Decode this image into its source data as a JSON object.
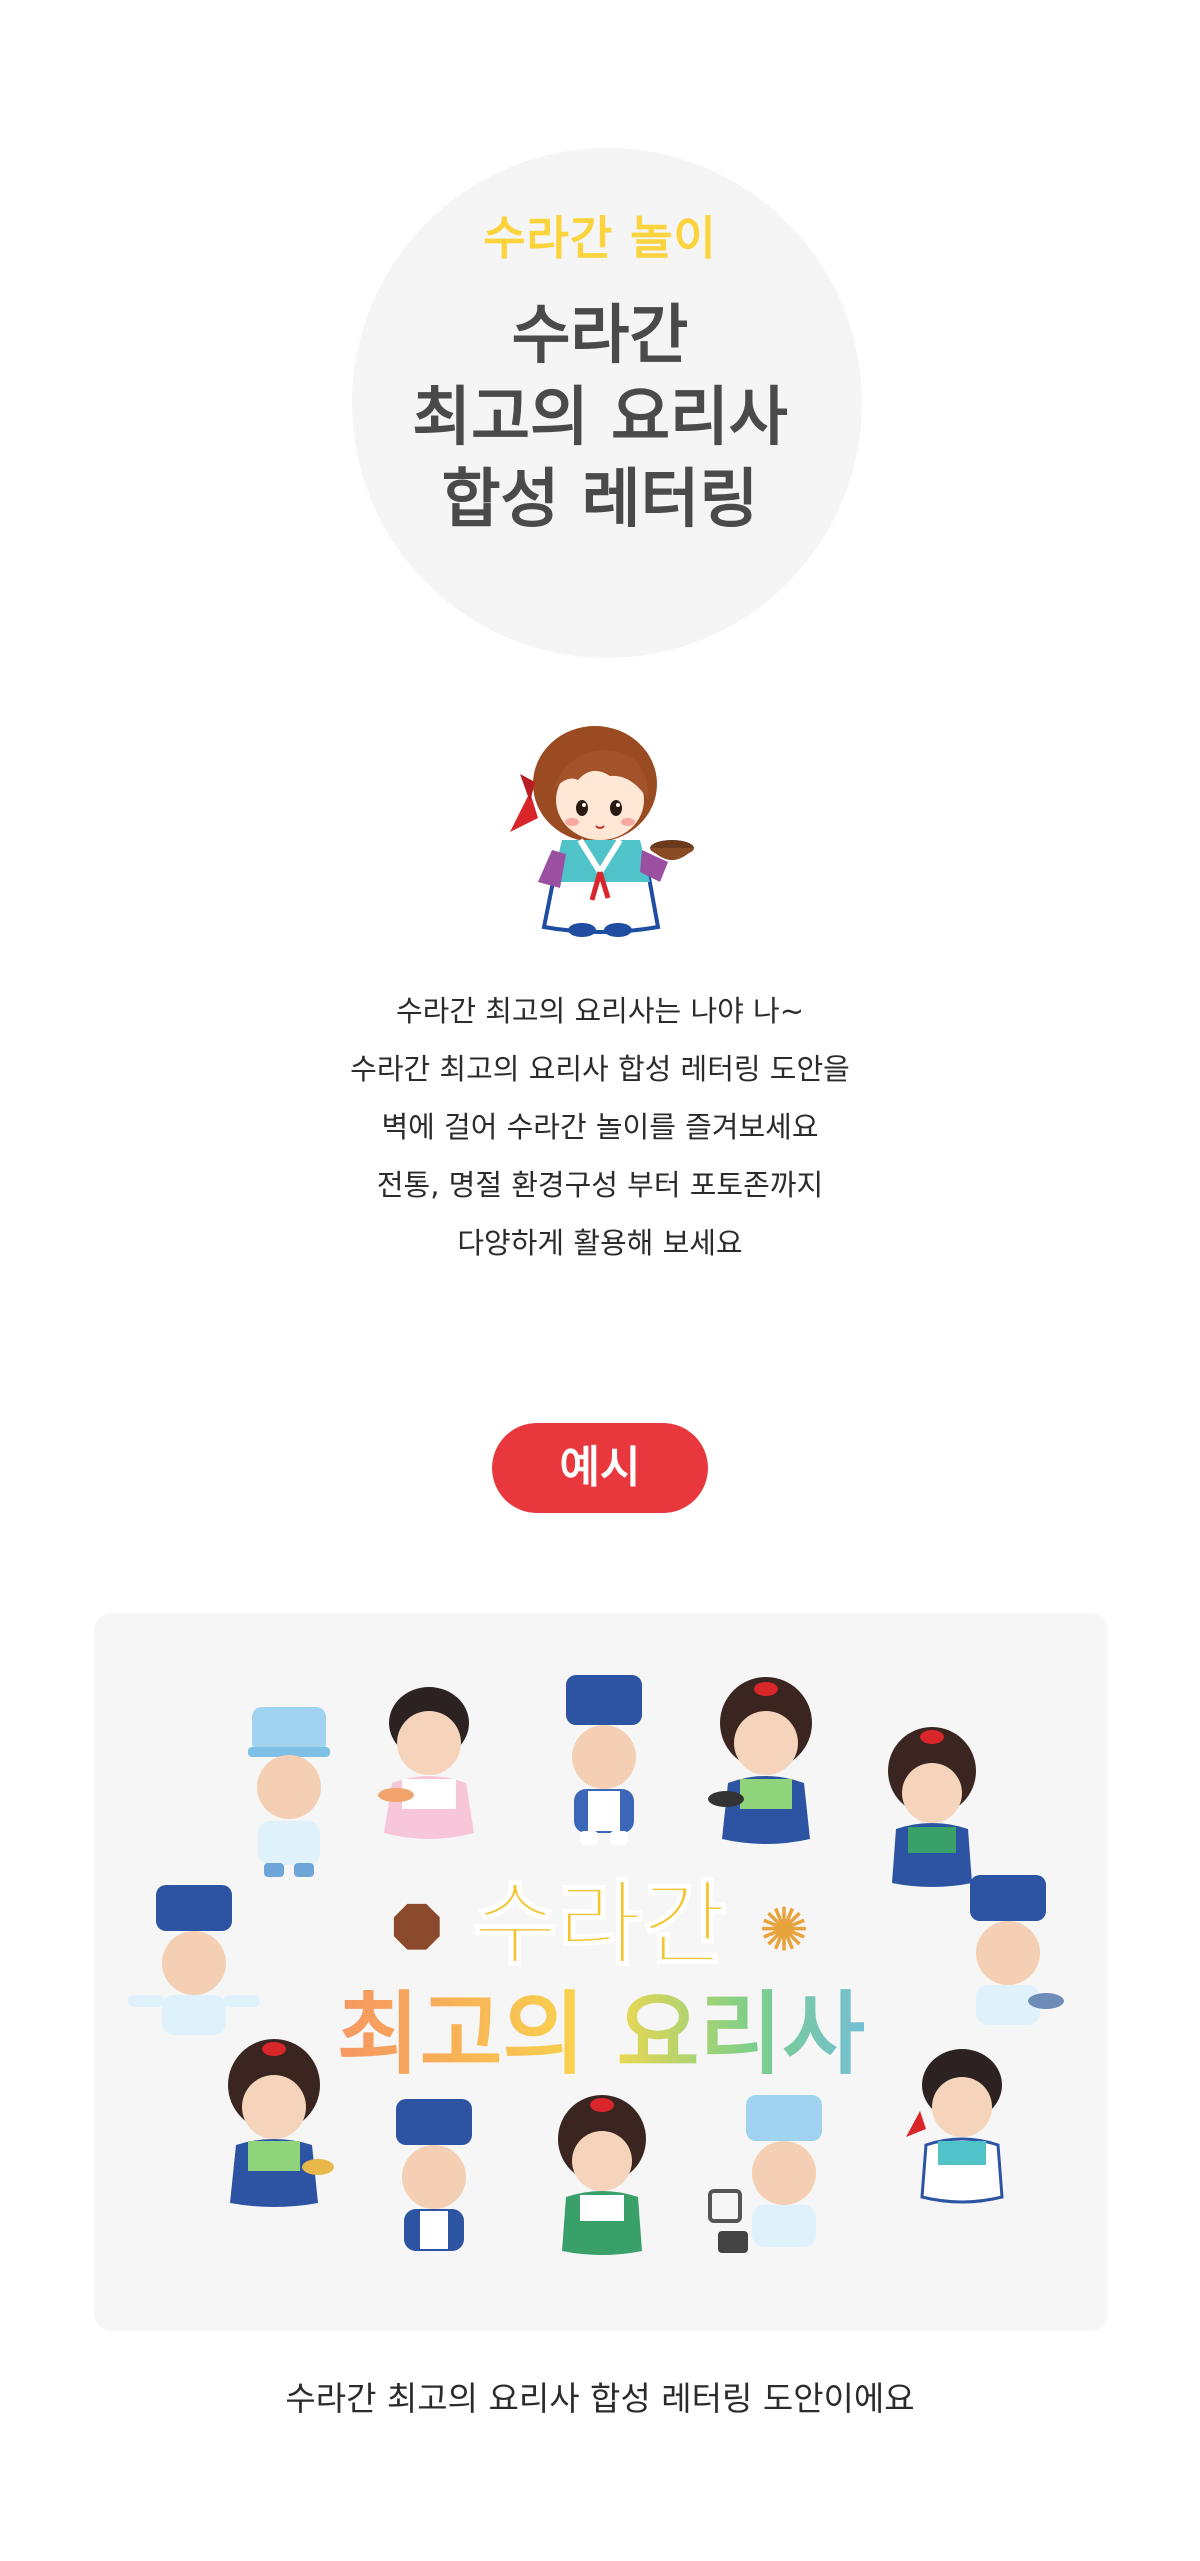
{
  "hero": {
    "subtitle": "수라간 놀이",
    "title_lines": [
      "수라간",
      "최고의 요리사",
      "합성 레터링"
    ]
  },
  "description": {
    "lines": [
      "수라간 최고의 요리사는 나야 나~",
      "수라간 최고의 요리사 합성 레터링 도안을",
      "벽에 걸어 수라간 놀이를 즐겨보세요",
      "전통, 명절 환경구성 부터 포토존까지",
      "다양하게 활용해 보세요"
    ]
  },
  "example": {
    "badge": "예시",
    "banner_title": "수라간",
    "banner_subtitle": "최고의 요리사",
    "caption": "수라간 최고의 요리사 합성 레터링 도안이에요"
  },
  "colors": {
    "subtitle": "#fbd33c",
    "badge": "#e8383d",
    "panel": "#f6f6f6",
    "circle": "#f5f5f5"
  }
}
